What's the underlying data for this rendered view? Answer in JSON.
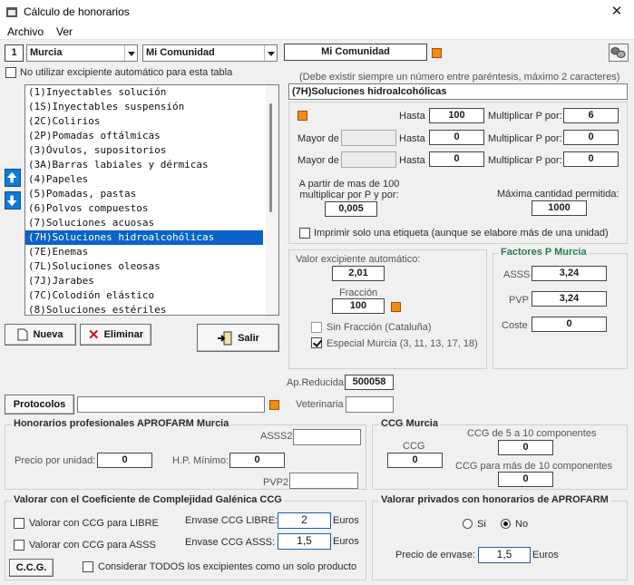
{
  "window": {
    "title": "Cálculo de honorarios",
    "close_glyph": "✕"
  },
  "menu": [
    "Archivo",
    "Ver"
  ],
  "toolbar": {
    "index": "1",
    "region": "Murcia",
    "community_select": "Mi Comunidad",
    "community_label": "Mi Comunidad"
  },
  "no_excipient": "No utilizar excipiente automático para esta tabla",
  "hint": "(Debe existir siempre un número entre paréntesis, máximo 2 caracteres)",
  "selected_name": "(7H)Soluciones hidroalcohólicas",
  "list_items": [
    "(1)Inyectables solución",
    "(1S)Inyectables suspensión",
    "(2C)Colirios",
    "(2P)Pomadas oftálmicas",
    "(3)Óvulos, supositorios",
    "(3A)Barras labiales y dérmicas",
    "(4)Papeles",
    "(5)Pomadas, pastas",
    "(6)Polvos compuestos",
    "(7)Soluciones acuosas",
    "(7H)Soluciones hidroalcohólicas",
    "(7E)Enemas",
    "(7L)Soluciones oleosas",
    "(7J)Jarabes",
    "(7C)Colodión elástico",
    "(8)Soluciones estériles"
  ],
  "selected_index": 10,
  "ranges": {
    "hasta": "Hasta",
    "mayor_de": "Mayor de",
    "multiplicar": "Multiplicar P por:",
    "row1": {
      "hasta": "100",
      "mult": "6"
    },
    "row2": {
      "hasta": "0",
      "mult": "0"
    },
    "row3": {
      "hasta": "0",
      "mult": "0"
    },
    "a_partir_label": "A partir de mas de 100\nmultiplicar por P y por:",
    "a_partir_value": "0,005",
    "max_label": "Máxima cantidad permitida:",
    "max_value": "1000",
    "print_one": "Imprimir solo una etiqueta (aunque se elabore más de una unidad)"
  },
  "excipient": {
    "label": "Valor excipiente automático:",
    "value": "2,01",
    "fraction_label": "Fracción",
    "fraction_value": "100",
    "sin_fraccion": "Sin Fracción (Cataluña)",
    "especial": "Especial Murcia (3, 11, 13, 17, 18)"
  },
  "factors": {
    "title": "Factores P Murcia",
    "asss_label": "ASSS",
    "asss": "3,24",
    "pvp_label": "PVP",
    "pvp": "3,24",
    "coste_label": "Coste",
    "coste": "0"
  },
  "buttons": {
    "nueva": "Nueva",
    "eliminar": "Eliminar",
    "salir": "Salir",
    "protocolos": "Protocolos",
    "ccg": "C.C.G."
  },
  "ap_reducida_label": "Ap.Reducida",
  "ap_reducida": "500058",
  "veterinaria_label": "Veterinaria",
  "honorarios": {
    "title": "Honorarios profesionales APROFARM Murcia",
    "asss2": "ASSS2",
    "precio_label": "Precio por unidad:",
    "precio": "0",
    "hp_label": "H.P. Mínimo:",
    "hp": "0",
    "pvp2": "PVP2"
  },
  "ccg": {
    "title": "CCG Murcia",
    "ccg_label": "CCG",
    "ccg": "0",
    "c5_10_label": "CCG de 5 a 10 componentes",
    "c5_10": "0",
    "cmas10_label": "CCG para más de 10 componentes",
    "cmas10": "0"
  },
  "valorar": {
    "title": "Valorar con el Coeficiente de Complejidad Galénica CCG",
    "libre": "Valorar con CCG para LIBRE",
    "asss": "Valorar con CCG para ASSS",
    "envase_libre_label": "Envase CCG LIBRE:",
    "envase_libre": "2",
    "envase_asss_label": "Envase CCG ASSS:",
    "envase_asss": "1,5",
    "euros": "Euros",
    "todos": "Considerar TODOS los excipientes como un solo producto"
  },
  "privados": {
    "title": "Valorar privados con honorarios de APROFARM",
    "si": "Si",
    "no": "No",
    "precio_label": "Precio de envase:",
    "precio": "1,5",
    "euros": "Euros"
  },
  "colors": {
    "accent": "#0a64c8",
    "orange": "#f28c12"
  }
}
